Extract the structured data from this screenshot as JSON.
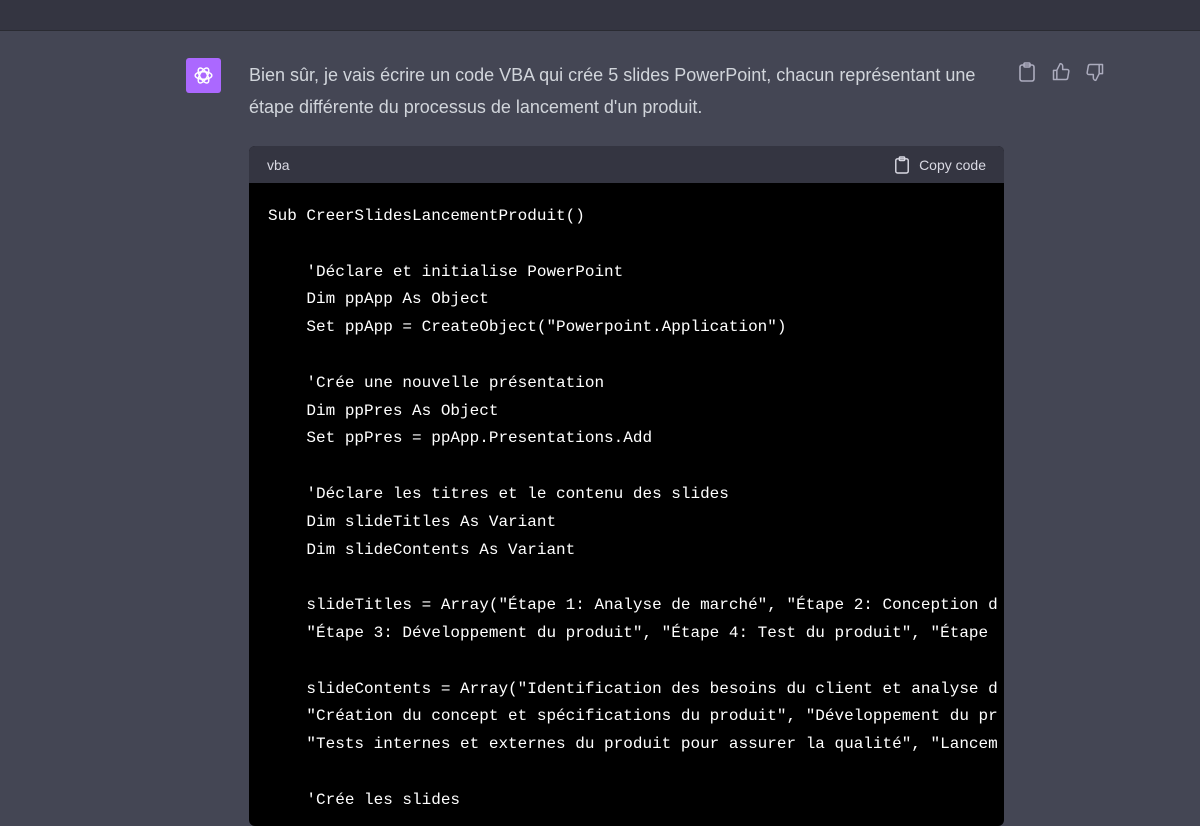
{
  "message": {
    "text": "Bien sûr, je vais écrire un code VBA qui crée 5 slides PowerPoint, chacun représentant une étape différente du processus de lancement d'un produit."
  },
  "code_block": {
    "language": "vba",
    "copy_label": "Copy code",
    "lines": [
      "Sub CreerSlidesLancementProduit()",
      "",
      "    'Déclare et initialise PowerPoint",
      "    Dim ppApp As Object",
      "    Set ppApp = CreateObject(\"Powerpoint.Application\")",
      "",
      "    'Crée une nouvelle présentation",
      "    Dim ppPres As Object",
      "    Set ppPres = ppApp.Presentations.Add",
      "",
      "    'Déclare les titres et le contenu des slides",
      "    Dim slideTitles As Variant",
      "    Dim slideContents As Variant",
      "",
      "    slideTitles = Array(\"Étape 1: Analyse de marché\", \"Étape 2: Conception d",
      "    \"Étape 3: Développement du produit\", \"Étape 4: Test du produit\", \"Étape",
      "",
      "    slideContents = Array(\"Identification des besoins du client et analyse d",
      "    \"Création du concept et spécifications du produit\", \"Développement du pr",
      "    \"Tests internes et externes du produit pour assurer la qualité\", \"Lancem",
      "",
      "    'Crée les slides"
    ]
  },
  "icons": {
    "avatar": "openai-logo-icon",
    "copy": "clipboard-icon",
    "like": "thumbs-up-icon",
    "dislike": "thumbs-down-icon"
  },
  "colors": {
    "background": "#444654",
    "topbar": "#343541",
    "avatar": "#ab68ff",
    "code_background": "#000000",
    "message_text": "#d1d5db"
  }
}
